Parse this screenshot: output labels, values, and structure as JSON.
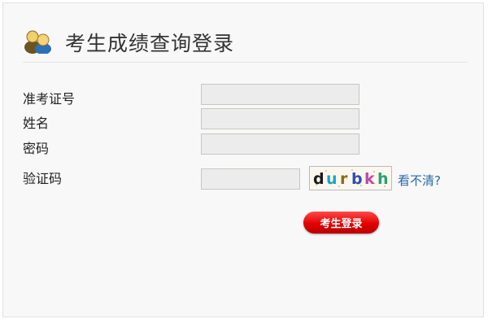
{
  "header": {
    "title": "考生成绩查询登录",
    "icon": "users-icon"
  },
  "form": {
    "ticket_label": "准考证号",
    "ticket_value": "",
    "name_label": "姓名",
    "name_value": "",
    "password_label": "密码",
    "password_value": "",
    "captcha_label": "验证码",
    "captcha_value": "",
    "captcha_text": "durbkh",
    "refresh_captcha_link": "看不清?",
    "login_button": "考生登录"
  },
  "colors": {
    "accent_button": "#e40000",
    "link": "#2a6aa8"
  }
}
